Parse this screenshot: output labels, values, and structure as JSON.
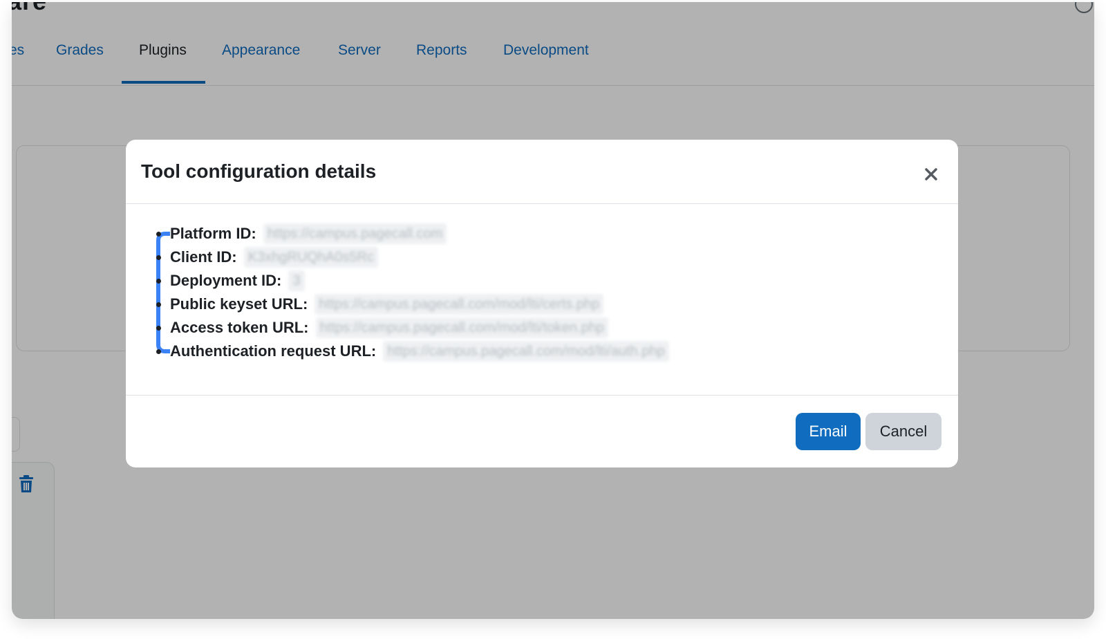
{
  "header": {
    "brand_fragment": "are"
  },
  "tabs": [
    {
      "label": "es",
      "active": false
    },
    {
      "label": "Grades",
      "active": false
    },
    {
      "label": "Plugins",
      "active": true
    },
    {
      "label": "Appearance",
      "active": false
    },
    {
      "label": "Server",
      "active": false
    },
    {
      "label": "Reports",
      "active": false
    },
    {
      "label": "Development",
      "active": false
    }
  ],
  "modal": {
    "title": "Tool configuration details",
    "close_icon": "close-icon",
    "details": [
      {
        "label": "Platform ID:",
        "value": "https://campus.pagecall.com"
      },
      {
        "label": "Client ID:",
        "value": "K3xhgRUQhA0s5Rc"
      },
      {
        "label": "Deployment ID:",
        "value": "3"
      },
      {
        "label": "Public keyset URL:",
        "value": "https://campus.pagecall.com/mod/lti/certs.php"
      },
      {
        "label": "Access token URL:",
        "value": "https://campus.pagecall.com/mod/lti/token.php"
      },
      {
        "label": "Authentication request URL:",
        "value": "https://campus.pagecall.com/mod/lti/auth.php"
      }
    ],
    "email_label": "Email",
    "cancel_label": "Cancel"
  },
  "colors": {
    "accent": "#0f6cbf",
    "highlight": "#3b82f6",
    "backdrop": "rgba(0,0,0,0.30)"
  }
}
